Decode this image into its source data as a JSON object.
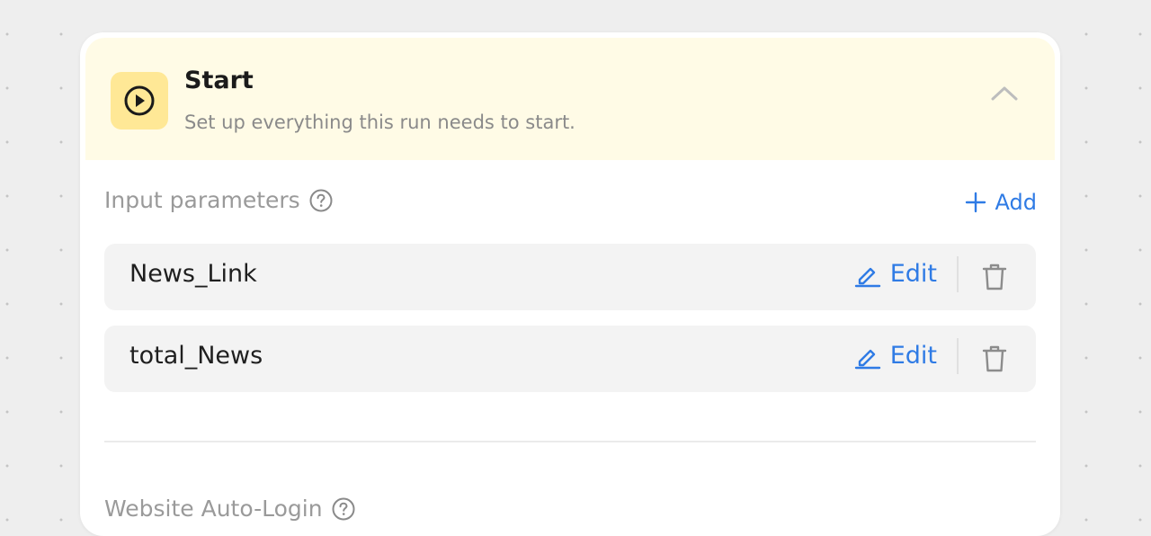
{
  "start": {
    "title": "Start",
    "subtitle": "Set up everything this run needs to start.",
    "icon": "play-circle-icon",
    "collapse_icon": "chevron-up-icon"
  },
  "input_parameters": {
    "label": "Input parameters",
    "help_icon": "help-circle-icon",
    "add_label": "Add",
    "items": [
      {
        "name": "News_Link",
        "edit_label": "Edit"
      },
      {
        "name": "total_News",
        "edit_label": "Edit"
      }
    ]
  },
  "website_auto_login": {
    "label": "Website Auto-Login"
  },
  "colors": {
    "accent": "#2f7be5",
    "header_bg": "#fffbe6",
    "badge_bg": "#ffe896"
  }
}
